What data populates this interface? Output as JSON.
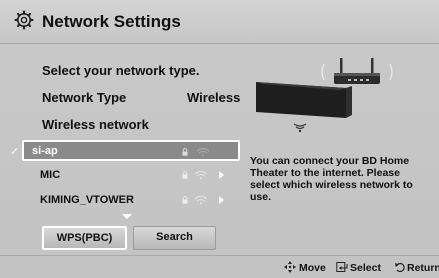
{
  "title": "Network Settings",
  "prompt": "Select your network type.",
  "network_type": {
    "label": "Network Type",
    "value": "Wireless"
  },
  "wireless_network_label": "Wireless network",
  "networks": [
    {
      "name": "si-ap",
      "selected": true,
      "check": "✓"
    },
    {
      "name": "MIC",
      "selected": false
    },
    {
      "name": "KIMING_VTOWER",
      "selected": false
    }
  ],
  "buttons": {
    "wps": "WPS(PBC)",
    "search": "Search"
  },
  "info_text": "You can connect your BD Home Theater to the internet. Please select which wireless network to use.",
  "footer": {
    "move": "Move",
    "select": "Select",
    "return": "Return"
  },
  "icons": {
    "title": "gear-icon",
    "router": "router-icon",
    "device": "home-theater-icon",
    "lock": "lock-icon",
    "wifi": "wifi-signal-icon",
    "move": "dpad-icon",
    "select": "enter-icon",
    "return": "return-icon"
  }
}
